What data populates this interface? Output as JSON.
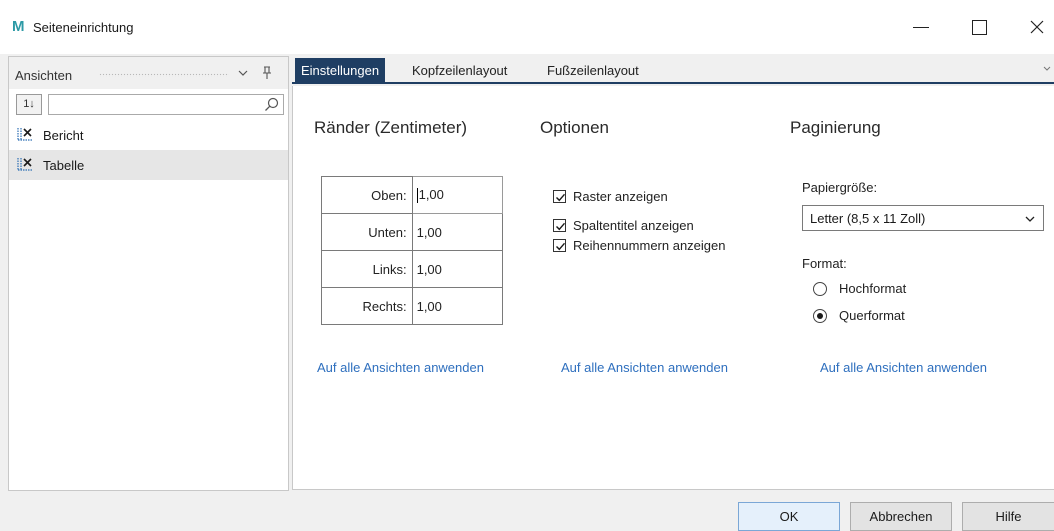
{
  "window": {
    "app_icon_glyph": "M",
    "title": "Seiteneinrichtung",
    "accent_color": "#1f3e63",
    "icon_color": "#2d9aa6"
  },
  "left_panel": {
    "title": "Ansichten",
    "sort_glyph": "1↓",
    "search_placeholder": "",
    "items": [
      {
        "label": "Bericht",
        "icon": "report-view-icon",
        "selected": false
      },
      {
        "label": "Tabelle",
        "icon": "table-view-icon",
        "selected": true
      }
    ]
  },
  "tabs": [
    {
      "label": "Einstellungen",
      "active": true
    },
    {
      "label": "Kopfzeilenlayout",
      "active": false
    },
    {
      "label": "Fußzeilenlayout",
      "active": false
    }
  ],
  "margins": {
    "title": "Ränder (Zentimeter)",
    "rows": [
      {
        "label": "Oben:",
        "value": "1,00"
      },
      {
        "label": "Unten:",
        "value": "1,00"
      },
      {
        "label": "Links:",
        "value": "1,00"
      },
      {
        "label": "Rechts:",
        "value": "1,00"
      }
    ],
    "apply_link": "Auf alle Ansichten anwenden"
  },
  "options": {
    "title": "Optionen",
    "checkboxes": [
      {
        "label": "Raster anzeigen",
        "checked": true
      },
      {
        "label": "Spaltentitel anzeigen",
        "checked": true
      },
      {
        "label": "Reihennummern anzeigen",
        "checked": true
      }
    ],
    "apply_link": "Auf alle Ansichten anwenden"
  },
  "pagination": {
    "title": "Paginierung",
    "paper_label": "Papiergröße:",
    "paper_value": "Letter (8,5 x 11 Zoll)",
    "format_label": "Format:",
    "formats": [
      {
        "label": "Hochformat",
        "selected": false
      },
      {
        "label": "Querformat",
        "selected": true
      }
    ],
    "apply_link": "Auf alle Ansichten anwenden"
  },
  "footer": {
    "ok": "OK",
    "cancel": "Abbrechen",
    "help": "Hilfe"
  }
}
